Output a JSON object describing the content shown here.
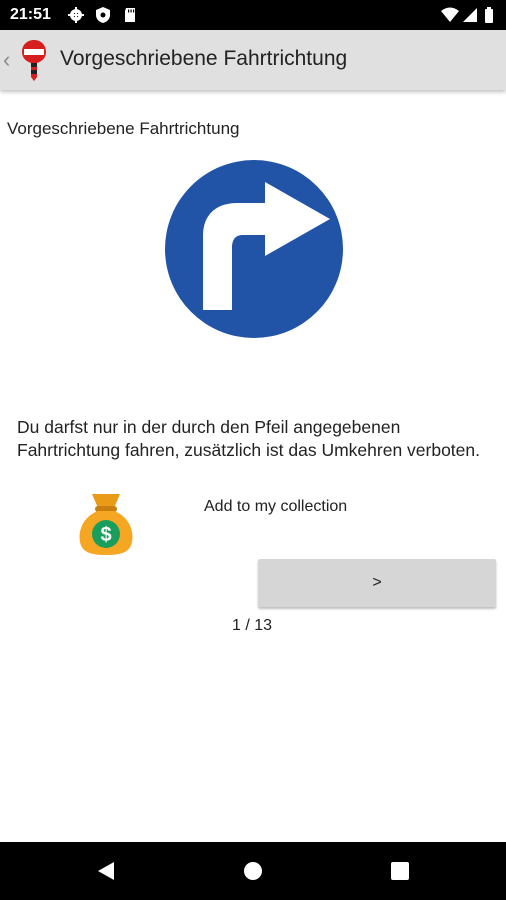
{
  "status_bar": {
    "time": "21:51",
    "left_icons": [
      "gear-icon",
      "shield-icon",
      "sd-card-icon"
    ],
    "right_icons": [
      "wifi-icon",
      "cellular-signal-icon",
      "battery-icon"
    ]
  },
  "app_bar": {
    "title": "Vorgeschriebene Fahrtrichtung",
    "back_glyph": "‹",
    "app_icon": "traffic-sign-app-icon"
  },
  "sign": {
    "title": "Vorgeschriebene Fahrtrichtung",
    "icon": "mandatory-turn-right-sign-icon",
    "colors": {
      "circle": "#2153a6",
      "arrow": "#ffffff"
    }
  },
  "description": "Du darfst nur in der durch den Pfeil angegebenen Fahrtrichtung fahren, zusätzlich ist das Umkehren verboten.",
  "collection": {
    "label": "Add to my collection",
    "icon": "money-bag-icon",
    "colors": {
      "bag": "#f5a623",
      "coin": "#1a9e5c"
    }
  },
  "navigation": {
    "next_label": ">",
    "page_counter": "1 / 13"
  },
  "system_nav": {
    "buttons": [
      "back-triangle-icon",
      "home-circle-icon",
      "recents-square-icon"
    ]
  }
}
